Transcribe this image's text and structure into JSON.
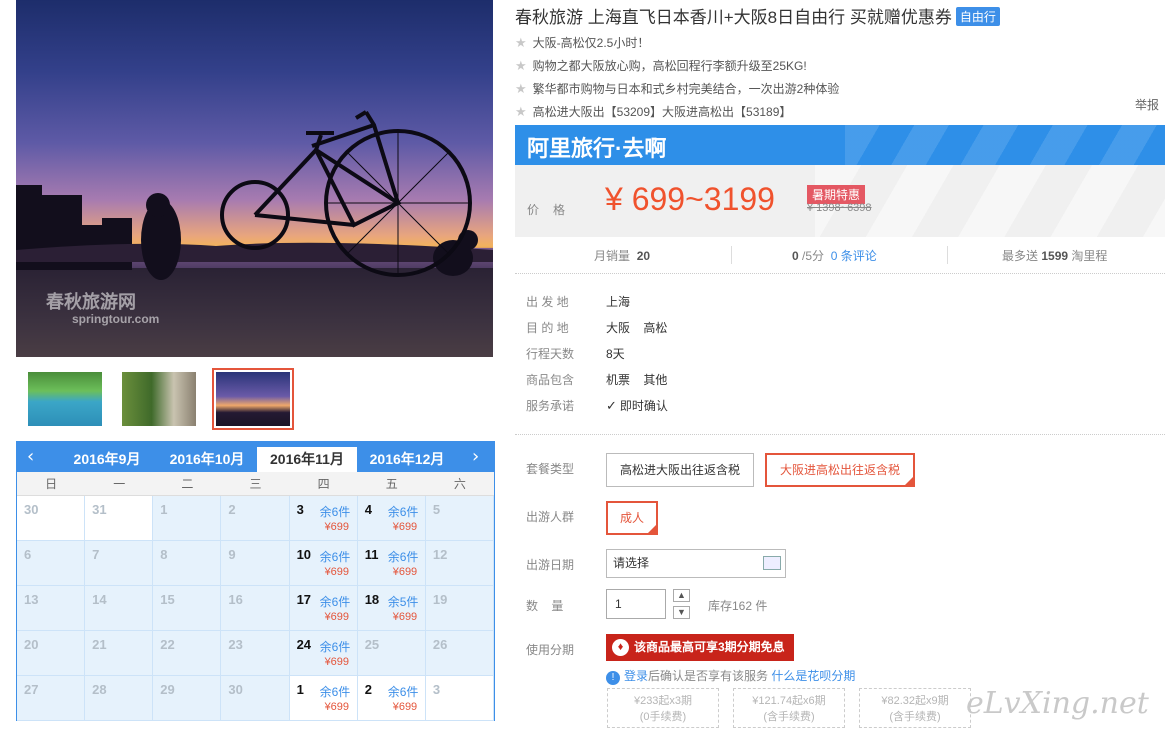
{
  "product": {
    "title": "春秋旅游 上海直飞日本香川+大阪8日自由行 买就赠优惠券",
    "tag": "自由行",
    "features": [
      "大阪-高松仅2.5小时！",
      "购物之都大阪放心购，高松回程行李额升级至25KG!",
      "繁华都市购物与日本和式乡村完美结合，一次出游2种体验",
      "高松进大阪出【53209】大阪进高松出【53189】"
    ],
    "report_label": "举报"
  },
  "gallery": {
    "watermark_cn": "春秋旅游网",
    "watermark_en": "springtour.com",
    "thumbnails": [
      "thumb-pool",
      "thumb-pine",
      "thumb-bicycle"
    ],
    "active_thumb": 2
  },
  "calendar": {
    "months": [
      "2016年9月",
      "2016年10月",
      "2016年11月",
      "2016年12月"
    ],
    "active_month": "2016年11月",
    "weekdays": [
      "日",
      "一",
      "二",
      "三",
      "四",
      "五",
      "六"
    ],
    "weeks": [
      [
        {
          "d": "30",
          "w": 1
        },
        {
          "d": "31",
          "w": 1
        },
        {
          "d": "1"
        },
        {
          "d": "2"
        },
        {
          "d": "3",
          "s": "余6件",
          "p": "¥699"
        },
        {
          "d": "4",
          "s": "余6件",
          "p": "¥699"
        },
        {
          "d": "5"
        }
      ],
      [
        {
          "d": "6"
        },
        {
          "d": "7"
        },
        {
          "d": "8"
        },
        {
          "d": "9"
        },
        {
          "d": "10",
          "s": "余6件",
          "p": "¥699"
        },
        {
          "d": "11",
          "s": "余6件",
          "p": "¥699"
        },
        {
          "d": "12"
        }
      ],
      [
        {
          "d": "13"
        },
        {
          "d": "14"
        },
        {
          "d": "15"
        },
        {
          "d": "16"
        },
        {
          "d": "17",
          "s": "余6件",
          "p": "¥699"
        },
        {
          "d": "18",
          "s": "余5件",
          "p": "¥699"
        },
        {
          "d": "19"
        }
      ],
      [
        {
          "d": "20"
        },
        {
          "d": "21"
        },
        {
          "d": "22"
        },
        {
          "d": "23"
        },
        {
          "d": "24",
          "s": "余6件",
          "p": "¥699"
        },
        {
          "d": "25"
        },
        {
          "d": "26"
        }
      ],
      [
        {
          "d": "27"
        },
        {
          "d": "28"
        },
        {
          "d": "29"
        },
        {
          "d": "30"
        },
        {
          "d": "1",
          "s": "余6件",
          "p": "¥699",
          "w": 1
        },
        {
          "d": "2",
          "s": "余6件",
          "p": "¥699",
          "w": 1
        },
        {
          "d": "3",
          "w": 1
        }
      ]
    ]
  },
  "brand": {
    "name": "阿里旅行·去啊"
  },
  "price": {
    "label": "价格",
    "range": "¥ 699~3199",
    "badge": "暑期特惠",
    "original": "¥ 1398~6398"
  },
  "stats": {
    "monthly_sales_label": "月销量",
    "monthly_sales": "20",
    "rating": "0",
    "rating_suffix": "/5分",
    "reviews": "0 条评论",
    "miles_prefix": "最多送",
    "miles": "1599",
    "miles_suffix": "淘里程"
  },
  "info": [
    {
      "k": "出 发 地",
      "v": "上海"
    },
    {
      "k": "目 的 地",
      "v": "大阪    高松"
    },
    {
      "k": "行程天数",
      "v": "8天"
    },
    {
      "k": "商品包含",
      "v": "机票    其他"
    },
    {
      "k": "服务承诺",
      "v": "即时确认"
    }
  ],
  "options": {
    "package_label": "套餐类型",
    "packages": [
      "高松进大阪出往返含税",
      "大阪进高松出往返含税"
    ],
    "selected_package": 1,
    "people_label": "出游人群",
    "people_value": "成人",
    "date_label": "出游日期",
    "date_placeholder": "请选择",
    "qty_label": "数    量",
    "qty_value": "1",
    "stock": "库存162 件",
    "installment_label": "使用分期",
    "installment_button": "该商品最高可享3期分期免息",
    "installment_note_login": "登录",
    "installment_note_text": "后确认是否享有该服务",
    "installment_note_link": "什么是花呗分期",
    "plans": [
      {
        "line1": "¥233起x3期",
        "line2": "(0手续费)"
      },
      {
        "line1": "¥121.74起x6期",
        "line2": "(含手续费)"
      },
      {
        "line1": "¥82.32起x9期",
        "line2": "(含手续费)"
      }
    ]
  },
  "watermark": "eLvXing.net"
}
